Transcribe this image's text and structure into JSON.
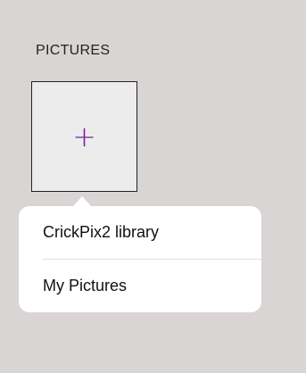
{
  "section": {
    "title": "PICTURES"
  },
  "add_tile": {
    "icon": "plus-icon",
    "glyph": "+",
    "color": "#7a1fa2"
  },
  "popover": {
    "items": [
      {
        "label": "CrickPix2 library"
      },
      {
        "label": "My Pictures"
      }
    ]
  },
  "colors": {
    "background": "#d9d5d4",
    "accent": "#7a1fa2",
    "popover": "#ffffff"
  }
}
